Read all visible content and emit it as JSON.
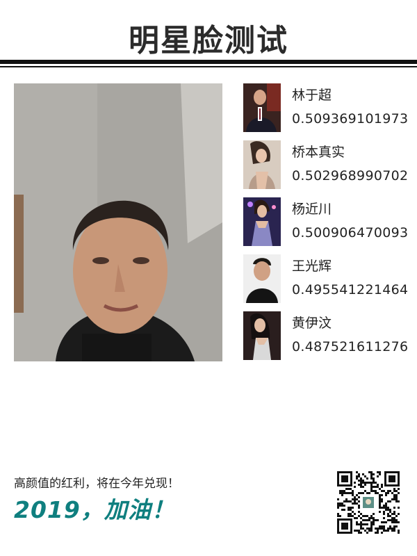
{
  "header": {
    "title": "明星脸测试"
  },
  "matches": [
    {
      "name": "林于超",
      "score": "0.509369101973"
    },
    {
      "name": "桥本真实",
      "score": "0.502968990702"
    },
    {
      "name": "杨近川",
      "score": "0.500906470093"
    },
    {
      "name": "王光辉",
      "score": "0.495541221464"
    },
    {
      "name": "黄伊汶",
      "score": "0.487521611276"
    }
  ],
  "footer": {
    "slogan": "高颜值的红利，将在今年兑现！",
    "cheer": "2019，加油！"
  },
  "colors": {
    "accent": "#0f7f7f",
    "rule": "#111111"
  }
}
